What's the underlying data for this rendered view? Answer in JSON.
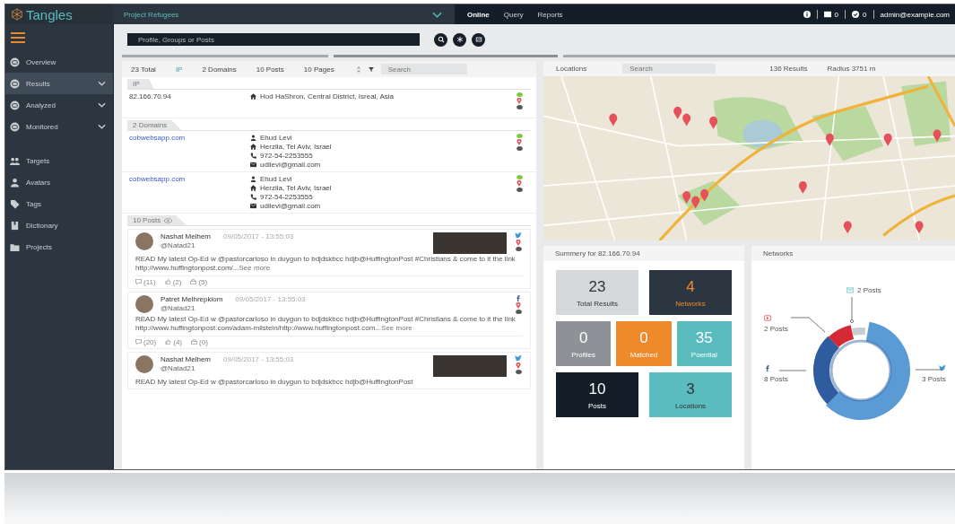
{
  "brand": "Tangles",
  "project": "Project Refugees",
  "nav": [
    {
      "label": "Online",
      "selected": true
    },
    {
      "label": "Query",
      "selected": false
    },
    {
      "label": "Reports",
      "selected": false
    }
  ],
  "header_counts": [
    "0",
    "0"
  ],
  "user": "admin@example.com",
  "sidebar": [
    {
      "label": "Overview",
      "kind": "link",
      "selected": false
    },
    {
      "label": "Results",
      "kind": "group",
      "selected": true
    },
    {
      "label": "Analyzed",
      "kind": "group",
      "selected": false
    },
    {
      "label": "Monitored",
      "kind": "group",
      "selected": false
    },
    {
      "label": "Targets",
      "kind": "link",
      "selected": false
    },
    {
      "label": "Avatars",
      "kind": "link",
      "selected": false
    },
    {
      "label": "Tags",
      "kind": "link",
      "selected": false
    },
    {
      "label": "Dictionary",
      "kind": "link",
      "selected": false
    },
    {
      "label": "Projects",
      "kind": "link",
      "selected": false
    }
  ],
  "search": {
    "placeholder": "Profile, Groups or Posts"
  },
  "results": {
    "tabs": [
      {
        "label": "23 Total",
        "selected": false
      },
      {
        "label": "IP",
        "selected": true
      },
      {
        "label": "2 Domains",
        "selected": false
      },
      {
        "label": "10 Posts",
        "selected": false
      },
      {
        "label": "10 Pages",
        "selected": false
      }
    ],
    "search_placeholder": "Search",
    "ip_section": {
      "title": "IP",
      "rows": [
        {
          "ip": "82.166.70.94",
          "address": "Hod HaShron, Central District, Isreal, Asia"
        }
      ]
    },
    "domain_section": {
      "title": "2 Domains",
      "rows": [
        {
          "domain": "cobwebsapp.com",
          "name": "Ehud Levi",
          "address": "Herzlia, Tel Aviv, Israel",
          "phone": "972-54-2253555",
          "email": "udilevi@gmail.com"
        },
        {
          "domain": "cobwebsapp.com",
          "name": "Ehud Levi",
          "address": "Herzlia, Tel Aviv, Israel",
          "phone": "972-54-2253555",
          "email": "udilevi@gmail.com"
        }
      ]
    },
    "posts_section": {
      "title": "10 Posts",
      "posts": [
        {
          "author": "Nashat Melhem",
          "time": "09/05/2017 - 13:55:03",
          "handle": "@Natad21",
          "kind": "twitter",
          "has_image": true,
          "text": "READ My latest Op-Ed w @pastorcarloso in duygun to bdjdskbcc hdjb@HuffingtonPost #Christians & come to it the link http://www.huffingtonpost.com/...",
          "see_more": "See more",
          "stats": [
            "(11)",
            "(2)",
            "(5)"
          ]
        },
        {
          "author": "Patret Melhrepkiom",
          "time": "09/05/2017 - 13:55:03",
          "handle": "@Natad21",
          "kind": "facebook",
          "has_image": false,
          "text": "READ My latest Op-Ed w @pastorcarloso in duygun to bdjdskbcc hdjb@HuffingtonPost #Christians & come to it the link http://www.huffingtonpost.com/adam-milstein/http://www.huffingtonpost.com...",
          "see_more": "See more",
          "stats": [
            "(20)",
            "(4)",
            "(0)"
          ]
        },
        {
          "author": "Nashat Melhem",
          "time": "09/05/2017 - 13:55:03",
          "handle": "@Natad21",
          "kind": "twitter",
          "has_image": true,
          "text": "READ My latest Op-Ed w @pastorcarloso in duygun to bdjdskbcc hdjb@HuffingtonPost"
        }
      ]
    }
  },
  "locations": {
    "title": "Locations",
    "search_placeholder": "Search",
    "results": "136 Results",
    "radius": "Radius 3751 m"
  },
  "summary": {
    "title": "Summery for 82.166.70.94",
    "tiles": [
      {
        "value": "23",
        "label": "Total Results",
        "color": "#d5d8db",
        "kind": "light"
      },
      {
        "value": "4",
        "label": "Networks",
        "color": "#2c3640",
        "kind": "accent"
      },
      {
        "value": "0",
        "label": "Profiles",
        "color": "#8e9296",
        "kind": "dark"
      },
      {
        "value": "0",
        "label": "Matched",
        "color": "#ef8a2a",
        "kind": "dark"
      },
      {
        "value": "35",
        "label": "Poential",
        "color": "#5bbcbf",
        "kind": "dark"
      },
      {
        "value": "10",
        "label": "Posts",
        "color": "#141e28",
        "kind": "dark"
      },
      {
        "value": "3",
        "label": "Locations",
        "color": "#5bbcbf",
        "kind": "light"
      }
    ]
  },
  "networks": {
    "title": "Networks",
    "labels": [
      {
        "kind": "email",
        "text": "2 Posts"
      },
      {
        "kind": "youtube",
        "text": "2 Posts"
      },
      {
        "kind": "facebook",
        "text": "8 Posts"
      },
      {
        "kind": "twitter",
        "text": "3 Posts"
      }
    ]
  }
}
